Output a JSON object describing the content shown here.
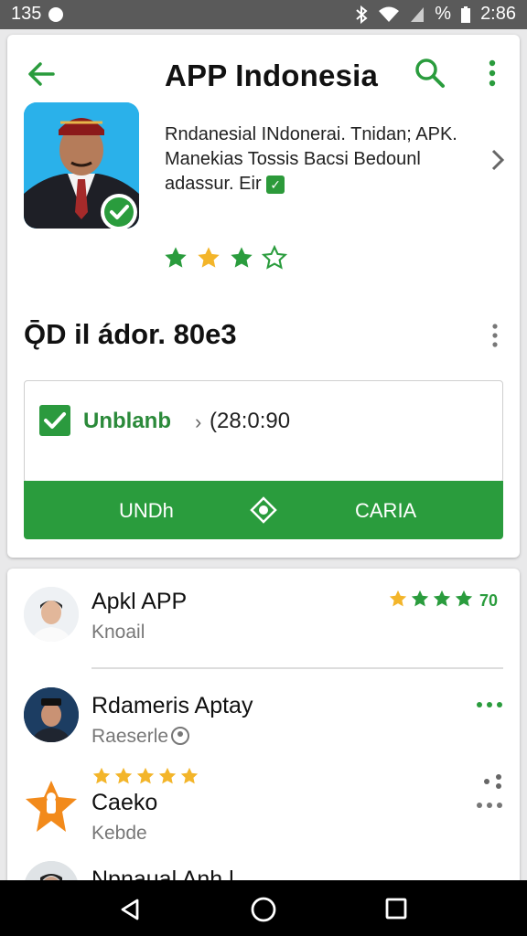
{
  "status_bar": {
    "time_left": "135",
    "time_right": "2:86",
    "battery_text": "%"
  },
  "header": {
    "title": "APP Indonesia"
  },
  "app_card": {
    "description_lines": [
      "Rndanesial INdonerai. Tnidan; APK.",
      "Manekias Tossis Bacsi Bedounl",
      "adassur. Eir"
    ],
    "rating": 3,
    "rating_max": 4
  },
  "section": {
    "title": "ǬD il ádor. 80e3"
  },
  "option": {
    "label": "Unblanb",
    "separator": "›",
    "value": "(28:0:90"
  },
  "actions": {
    "left_label": "UNDh",
    "right_label": "CARIA"
  },
  "list": {
    "items": [
      {
        "title": "Apkl APP",
        "subtitle": "Knoail",
        "rating_text": "70"
      },
      {
        "title": "Rdameris Aptay",
        "subtitle": "Raeserle"
      },
      {
        "title": "Caeko",
        "subtitle": "Kebde"
      },
      {
        "title": "Npnaual Anh l"
      }
    ]
  },
  "colors": {
    "accent_green": "#2a9c3d",
    "star_yellow": "#f3b52a"
  }
}
